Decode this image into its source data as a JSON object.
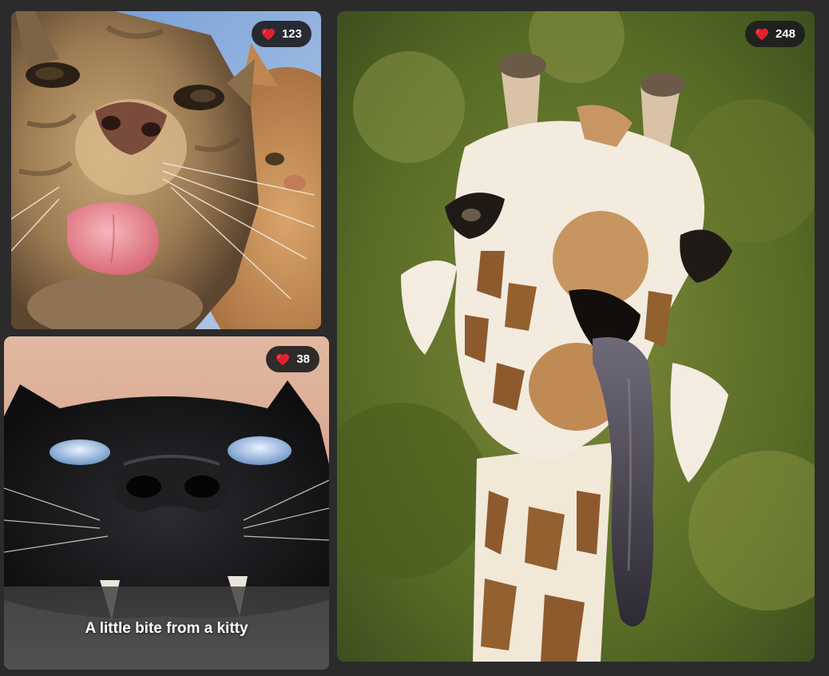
{
  "cards": [
    {
      "id": "cat-tongue",
      "likes": "123",
      "caption": ""
    },
    {
      "id": "black-cat",
      "likes": "38",
      "caption": "A little bite from a kitty"
    },
    {
      "id": "giraffe",
      "likes": "248",
      "caption": ""
    }
  ],
  "colors": {
    "background": "#2b2b2c",
    "badge_bg": "#1c1c1e",
    "heart": "#e0202f",
    "text": "#ffffff"
  },
  "icons": {
    "like": "heart-icon"
  }
}
